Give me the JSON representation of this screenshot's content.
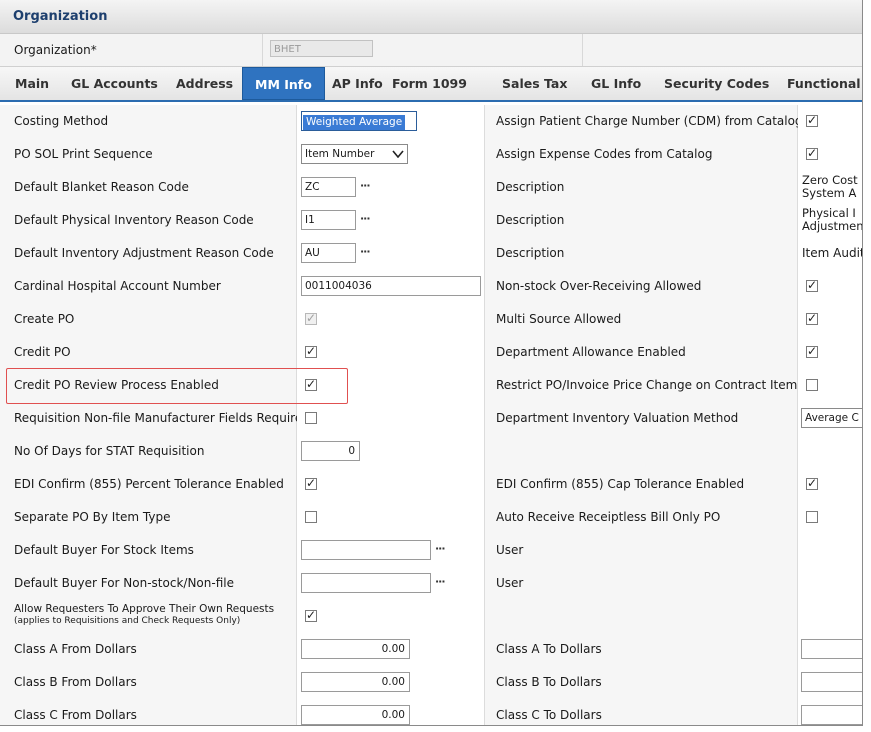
{
  "header": {
    "title": "Organization"
  },
  "org": {
    "label": "Organization*",
    "value": "BHET"
  },
  "tabs": [
    "Main",
    "GL Accounts",
    "Address",
    "MM Info",
    "AP Info",
    "Form 1099",
    "Sales Tax",
    "GL Info",
    "Security Codes",
    "Functional"
  ],
  "active_tab": "MM Info",
  "rows": [
    {
      "left_label": "Costing Method",
      "left_value": "Weighted Average",
      "right_label": "Assign Patient Charge Number (CDM) from Catalog",
      "right_checked": true
    },
    {
      "left_label": "PO SOL Print Sequence",
      "left_value": "Item Number",
      "right_label": "Assign Expense Codes from Catalog",
      "right_checked": true
    },
    {
      "left_label": "Default Blanket Reason Code",
      "left_value": "ZC",
      "right_label": "Description",
      "right_value_1": "Zero Cost",
      "right_value_2": "System A"
    },
    {
      "left_label": "Default Physical Inventory Reason Code",
      "left_value": "I1",
      "right_label": "Description",
      "right_value_1": "Physical I",
      "right_value_2": "Adjustmen"
    },
    {
      "left_label": "Default Inventory Adjustment Reason Code",
      "left_value": "AU",
      "right_label": "Description",
      "right_value_1": "Item Audit"
    },
    {
      "left_label": "Cardinal Hospital Account Number",
      "left_value": "0011004036",
      "right_label": "Non-stock Over-Receiving Allowed",
      "right_checked": true
    },
    {
      "left_label": "Create PO",
      "left_checked": true,
      "right_label": "Multi Source Allowed",
      "right_checked": true
    },
    {
      "left_label": "Credit PO",
      "left_checked": true,
      "right_label": "Department Allowance Enabled",
      "right_checked": true
    },
    {
      "left_label": "Credit PO Review Process Enabled",
      "left_checked": true,
      "right_label": "Restrict PO/Invoice Price Change on Contract Items",
      "right_checked": false
    },
    {
      "left_label": "Requisition Non-file Manufacturer Fields Required",
      "left_checked": false,
      "right_label": "Department Inventory Valuation Method",
      "right_value": "Average C"
    },
    {
      "left_label": "No Of Days for STAT Requisition",
      "left_value": "0"
    },
    {
      "left_label": "EDI Confirm (855) Percent Tolerance Enabled",
      "left_checked": true,
      "right_label": "EDI Confirm (855) Cap Tolerance Enabled",
      "right_checked": true
    },
    {
      "left_label": "Separate PO By Item Type",
      "left_checked": false,
      "right_label": "Auto Receive Receiptless Bill Only PO",
      "right_checked": false
    },
    {
      "left_label": "Default Buyer For Stock Items",
      "left_value": "",
      "right_label": "User"
    },
    {
      "left_label": "Default Buyer For Non-stock/Non-file",
      "left_value": "",
      "right_label": "User"
    },
    {
      "left_label": "Allow Requesters To Approve Their Own Requests",
      "left_sublabel": "(applies to Requisitions and Check Requests Only)",
      "left_checked": true
    },
    {
      "left_label": "Class A From Dollars",
      "left_value": "0.00",
      "right_label": "Class A To Dollars",
      "right_value": ""
    },
    {
      "left_label": "Class B From Dollars",
      "left_value": "0.00",
      "right_label": "Class B To Dollars",
      "right_value": ""
    },
    {
      "left_label": "Class C From Dollars",
      "left_value": "0.00",
      "right_label": "Class C To Dollars",
      "right_value": ""
    }
  ],
  "colors": {
    "accent": "#2f73c0",
    "title": "#1d3f6e",
    "highlight_box": "#e05050"
  }
}
